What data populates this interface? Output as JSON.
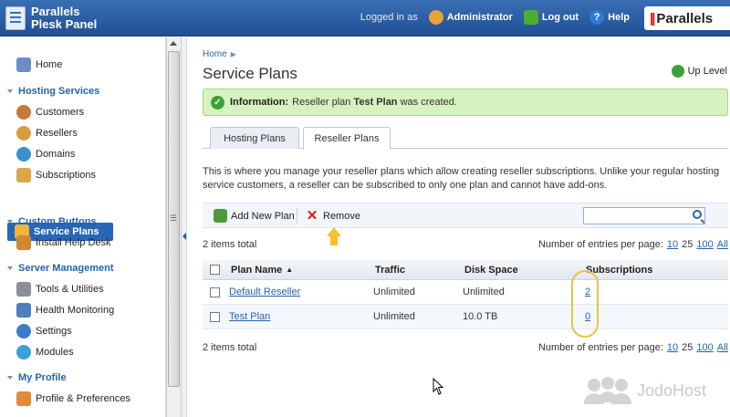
{
  "header": {
    "app_title_line1": "Parallels",
    "app_title_line2": "Plesk Panel",
    "logged_in_as": "Logged in as",
    "user": "Administrator",
    "logout": "Log out",
    "help": "Help",
    "brand": "Parallels"
  },
  "sidebar": {
    "home": "Home",
    "sections": [
      {
        "title": "Hosting Services",
        "items": [
          "Customers",
          "Resellers",
          "Domains",
          "Subscriptions",
          "Service Plans"
        ]
      },
      {
        "title": "Custom Buttons",
        "items": [
          "Install Help Desk"
        ]
      },
      {
        "title": "Server Management",
        "items": [
          "Tools & Utilities",
          "Health Monitoring",
          "Settings",
          "Modules"
        ]
      },
      {
        "title": "My Profile",
        "items": [
          "Profile & Preferences"
        ]
      }
    ]
  },
  "main": {
    "breadcrumb": "Home",
    "title": "Service Plans",
    "up_level": "Up Level",
    "info_label": "Information:",
    "info_pre": "Reseller plan",
    "info_plan": "Test Plan",
    "info_post": "was created.",
    "tabs": [
      "Hosting Plans",
      "Reseller Plans"
    ],
    "description": "This is where you manage your reseller plans which allow creating reseller subscriptions. Unlike your regular hosting service customers, a reseller can be subscribed to only one plan and cannot have add-ons.",
    "add_new_plan": "Add New Plan",
    "remove": "Remove",
    "search_value": "",
    "items_total": "2 items total",
    "entries_label": "Number of entries per page:",
    "entries_options": [
      "10",
      "25",
      "100",
      "All"
    ],
    "columns": [
      "Plan Name",
      "Traffic",
      "Disk Space",
      "Subscriptions"
    ],
    "rows": [
      {
        "name": "Default Reseller",
        "traffic": "Unlimited",
        "disk": "Unlimited",
        "subs": "2"
      },
      {
        "name": "Test Plan",
        "traffic": "Unlimited",
        "disk": "10.0 TB",
        "subs": "0"
      }
    ]
  },
  "watermark": "JodoHost",
  "colors": {
    "header_blue": "#2a5da3",
    "link_blue": "#2463ad",
    "active_nav": "#2867b6",
    "info_green": "#d6f2bf",
    "highlight": "#e0c640"
  }
}
